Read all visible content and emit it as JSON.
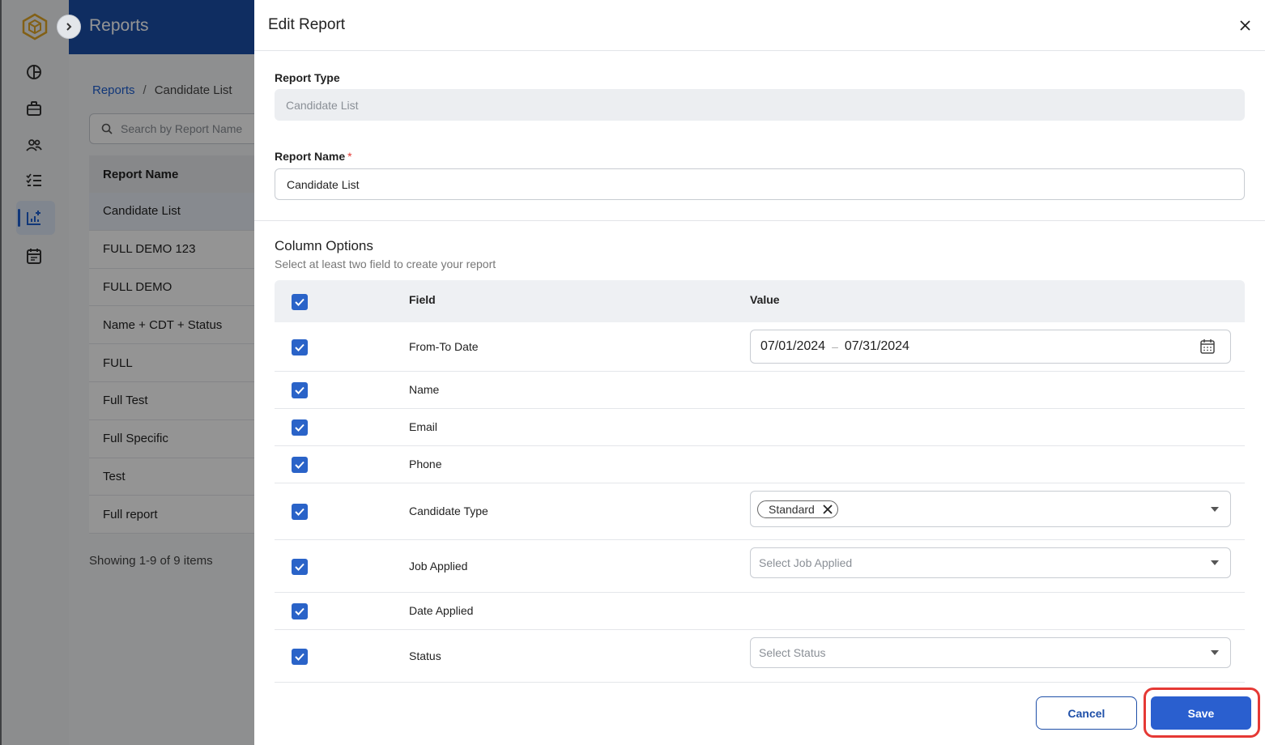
{
  "app": {
    "title": "Reports",
    "breadcrumb": {
      "root": "Reports",
      "separator": "/",
      "current": "Candidate List"
    },
    "search_placeholder": "Search by Report Name",
    "list_header": "Report Name",
    "reports": [
      "Candidate List",
      "FULL DEMO 123",
      "FULL DEMO",
      "Name + CDT + Status",
      "FULL",
      "Full Test",
      "Full Specific",
      "Test",
      "Full report"
    ],
    "showing": "Showing 1-9 of 9 items",
    "rail_icons": [
      "dashboard-icon",
      "briefcase-icon",
      "people-icon",
      "checklist-icon",
      "reports-icon",
      "calendar-icon"
    ]
  },
  "drawer": {
    "title": "Edit Report",
    "report_type": {
      "label": "Report Type",
      "value": "Candidate List"
    },
    "report_name": {
      "label": "Report Name",
      "required_mark": "*",
      "value": "Candidate List"
    },
    "column_options": {
      "title": "Column Options",
      "subtitle": "Select at least two field to create your report",
      "header_field": "Field",
      "header_value": "Value",
      "rows": [
        {
          "field": "From-To Date",
          "checked": true
        },
        {
          "field": "Name",
          "checked": true
        },
        {
          "field": "Email",
          "checked": true
        },
        {
          "field": "Phone",
          "checked": true
        },
        {
          "field": "Candidate Type",
          "checked": true
        },
        {
          "field": "Job Applied",
          "checked": true
        },
        {
          "field": "Date Applied",
          "checked": true
        },
        {
          "field": "Status",
          "checked": true
        }
      ],
      "date_range": {
        "from": "07/01/2024",
        "separator": "–",
        "to": "07/31/2024"
      },
      "candidate_type_chip": "Standard",
      "job_applied_placeholder": "Select Job Applied",
      "status_placeholder": "Select Status"
    },
    "cancel_label": "Cancel",
    "save_label": "Save"
  },
  "colors": {
    "primary": "#2a5fcf",
    "topbar": "#1a4fa8",
    "highlight": "#e53935"
  }
}
